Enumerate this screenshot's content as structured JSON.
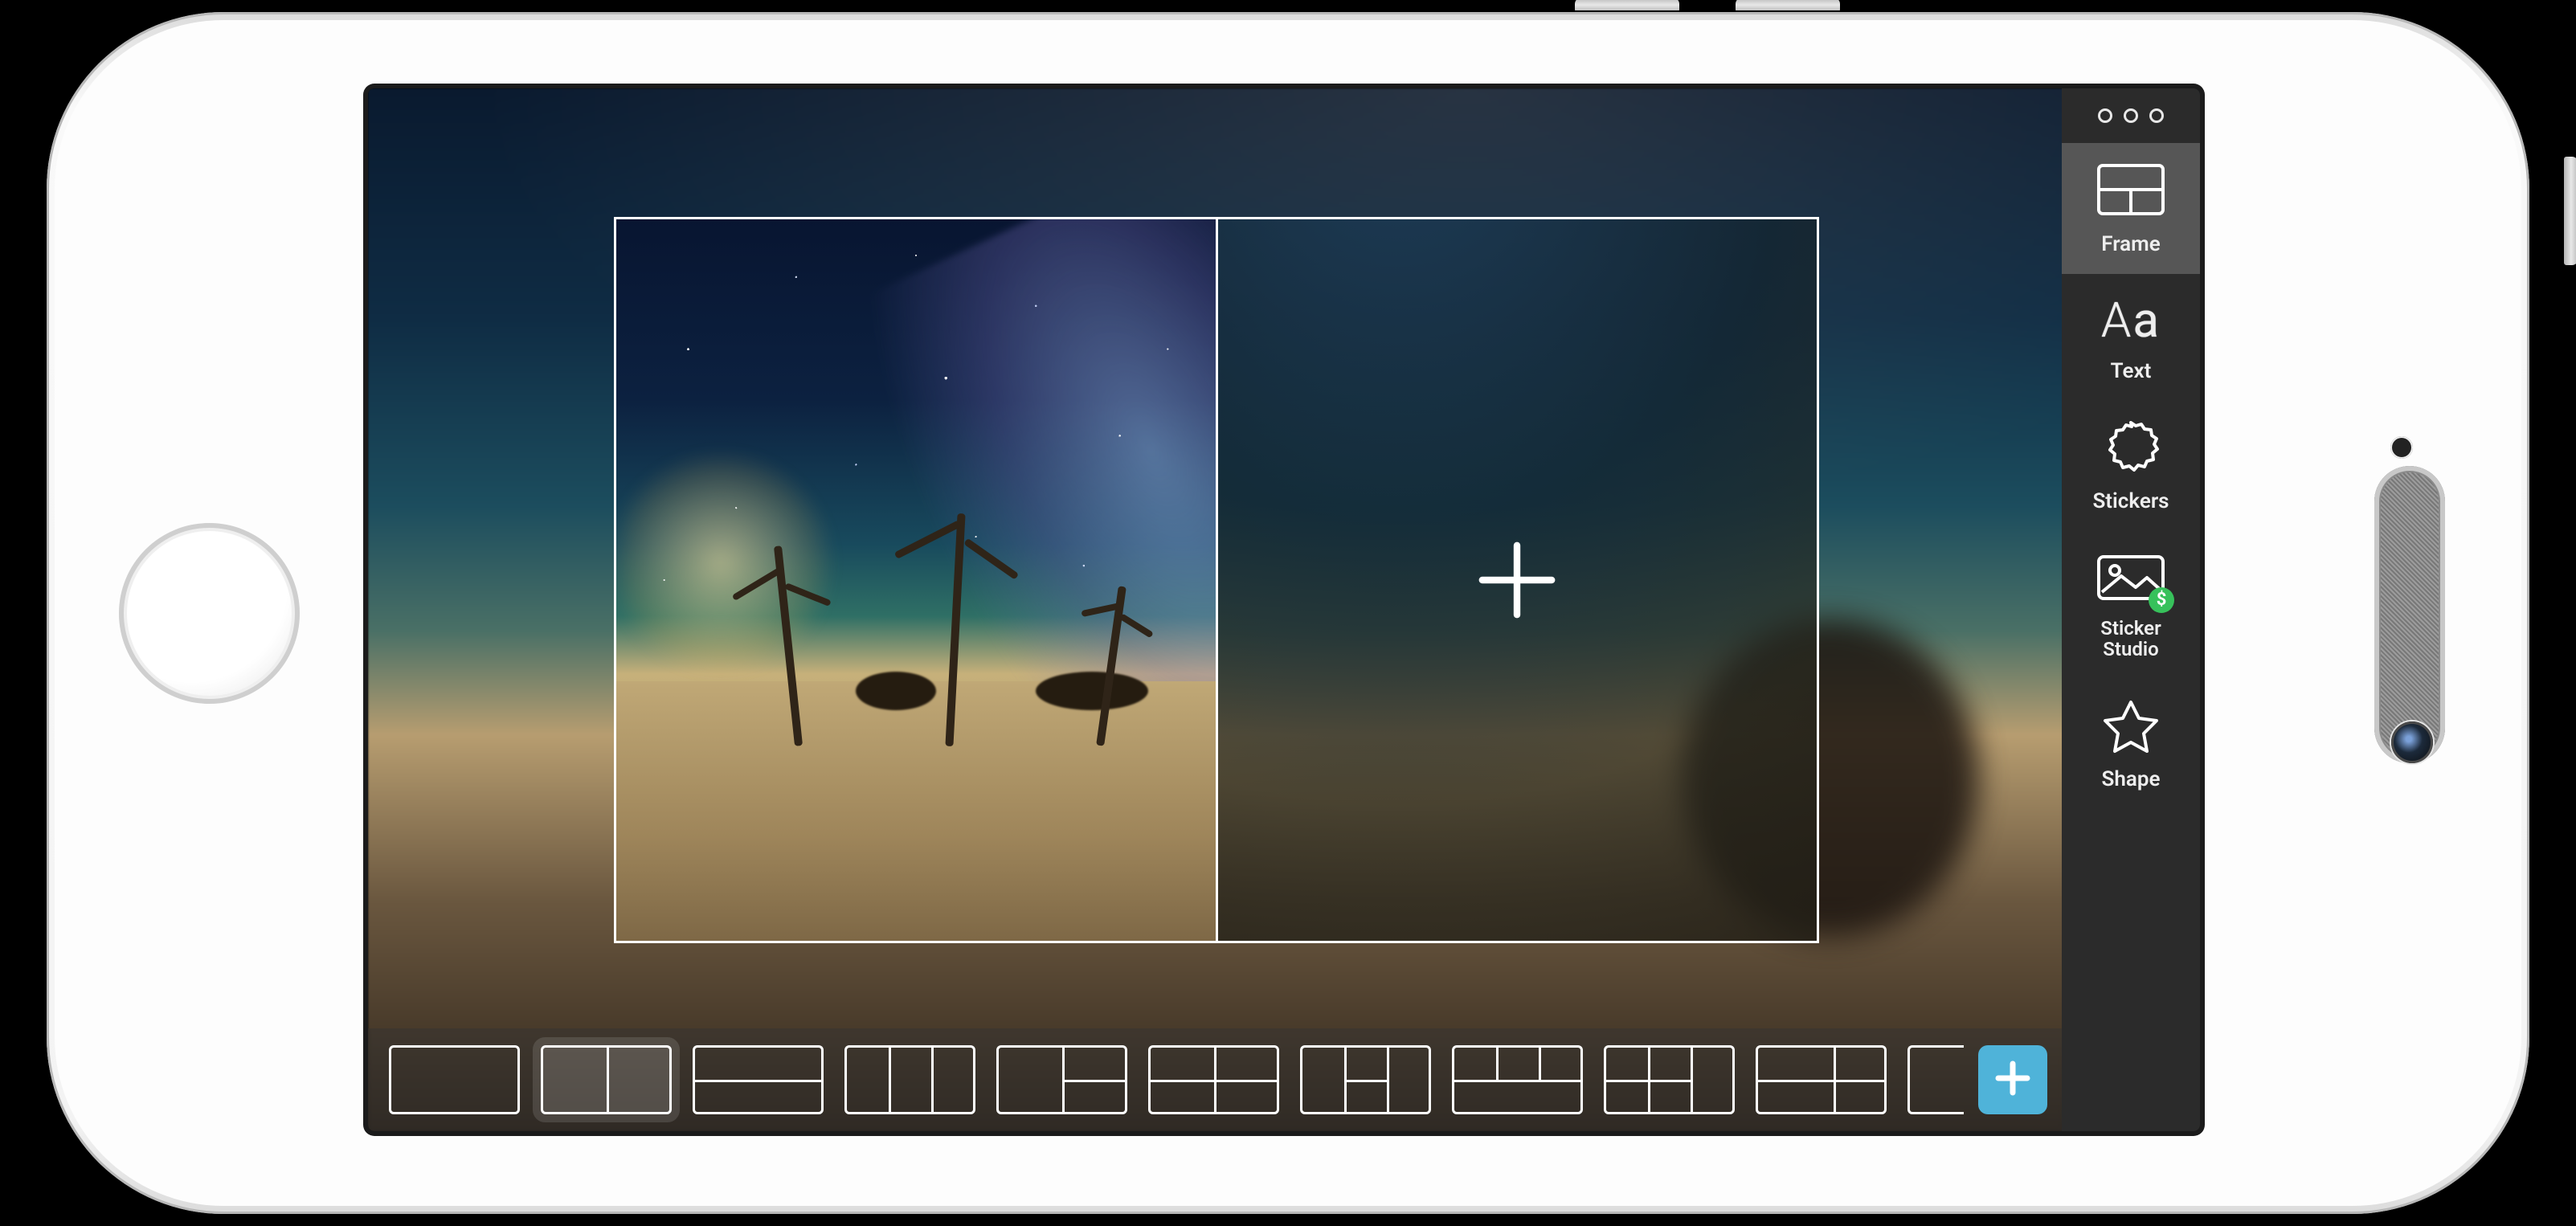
{
  "sidebar": {
    "items": [
      {
        "id": "frame",
        "label": "Frame",
        "selected": true
      },
      {
        "id": "text",
        "label": "Text",
        "selected": false
      },
      {
        "id": "stickers",
        "label": "Stickers",
        "selected": false
      },
      {
        "id": "sticker-studio",
        "label": "Sticker\nStudio",
        "selected": false,
        "paid": true,
        "paid_symbol": "$"
      },
      {
        "id": "shape",
        "label": "Shape",
        "selected": false
      }
    ]
  },
  "layouts": {
    "selected_index": 1,
    "items": [
      {
        "id": "1x1"
      },
      {
        "id": "2v"
      },
      {
        "id": "2h"
      },
      {
        "id": "3v"
      },
      {
        "id": "1v-2h"
      },
      {
        "id": "2x2"
      },
      {
        "id": "top-3bottom"
      },
      {
        "id": "1-3cols-top"
      },
      {
        "id": "3v-middle-split"
      },
      {
        "id": "2x2-shifted"
      },
      {
        "id": "partial"
      }
    ]
  },
  "collage": {
    "cells": 2,
    "filled": [
      true,
      false
    ]
  },
  "colors": {
    "accent": "#4fb3d9",
    "paid_badge": "#37c15b",
    "sidebar_bg": "#2b2b2b",
    "sidebar_active_bg": "#565656"
  }
}
